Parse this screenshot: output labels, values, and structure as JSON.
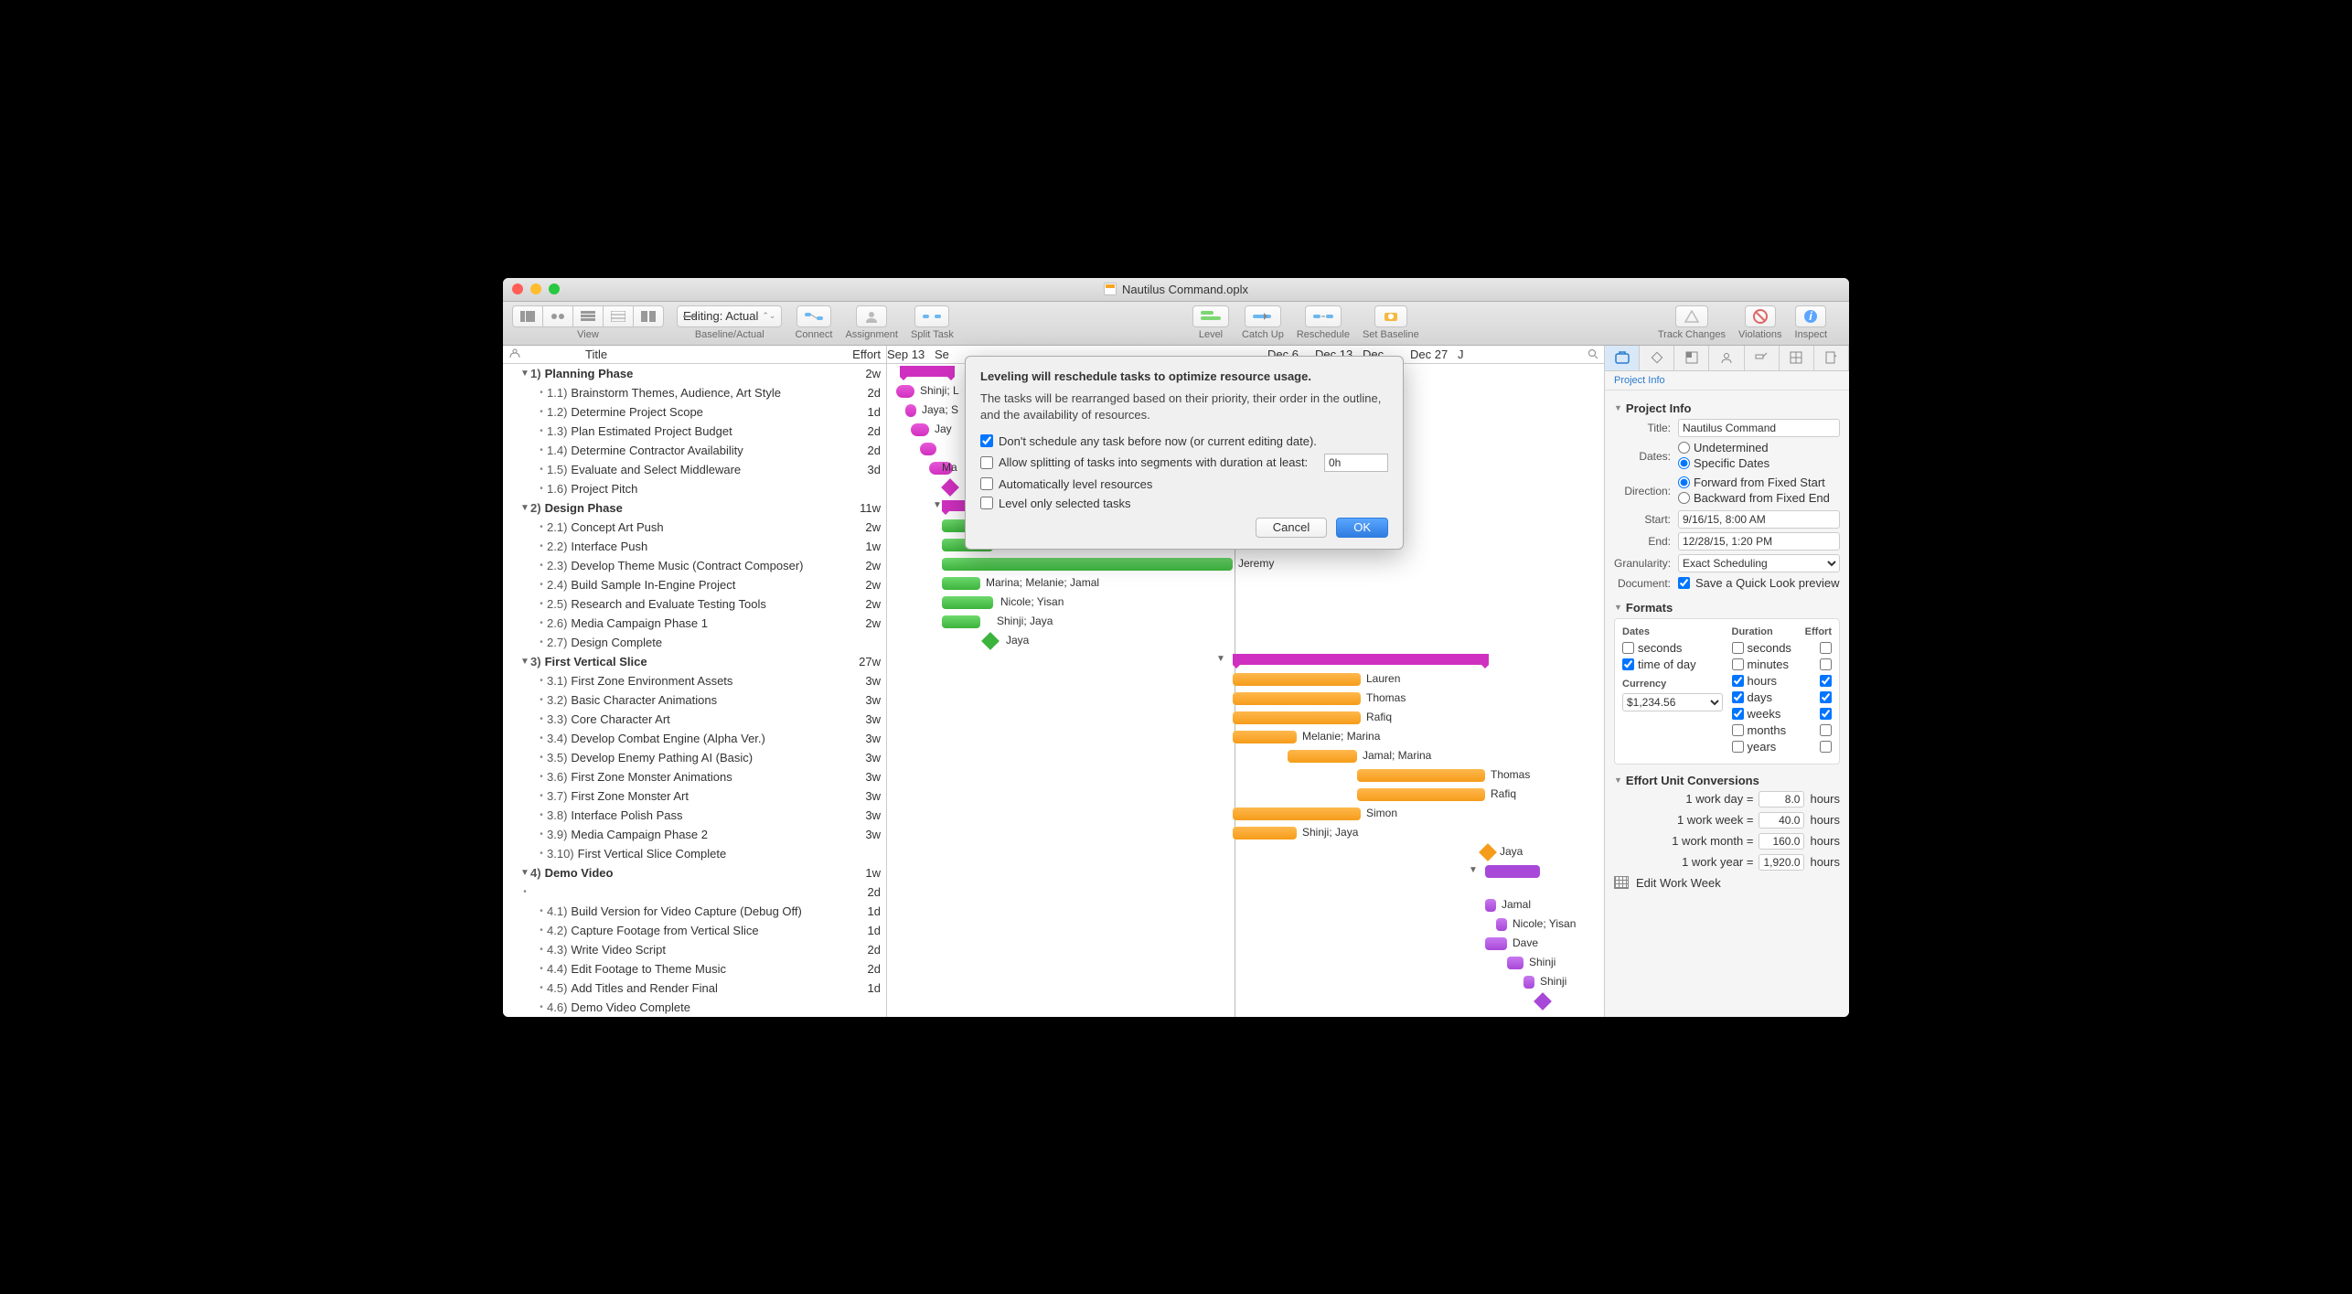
{
  "window_title": "Nautilus Command.oplx",
  "toolbar": {
    "view": "View",
    "baseline_actual": "Baseline/Actual",
    "editing_popup": "Editing: Actual",
    "connect": "Connect",
    "assignment": "Assignment",
    "split_task": "Split Task",
    "level": "Level",
    "catch_up": "Catch Up",
    "reschedule": "Reschedule",
    "set_baseline": "Set Baseline",
    "track_changes": "Track Changes",
    "violations": "Violations",
    "inspect": "Inspect"
  },
  "outline_header": {
    "title": "Title",
    "effort": "Effort"
  },
  "tasks": [
    {
      "lvl": 0,
      "grp": true,
      "num": "1)",
      "name": "Planning Phase",
      "effort": "2w"
    },
    {
      "lvl": 1,
      "num": "1.1)",
      "name": "Brainstorm Themes, Audience, Art Style",
      "effort": "2d"
    },
    {
      "lvl": 1,
      "num": "1.2)",
      "name": "Determine Project Scope",
      "effort": "1d"
    },
    {
      "lvl": 1,
      "num": "1.3)",
      "name": "Plan Estimated Project Budget",
      "effort": "2d"
    },
    {
      "lvl": 1,
      "num": "1.4)",
      "name": "Determine Contractor Availability",
      "effort": "2d"
    },
    {
      "lvl": 1,
      "num": "1.5)",
      "name": "Evaluate and Select Middleware",
      "effort": "3d"
    },
    {
      "lvl": 1,
      "num": "1.6)",
      "name": "Project Pitch",
      "effort": ""
    },
    {
      "lvl": 0,
      "grp": true,
      "num": "2)",
      "name": "Design Phase",
      "effort": "11w"
    },
    {
      "lvl": 1,
      "num": "2.1)",
      "name": "Concept Art Push",
      "effort": "2w"
    },
    {
      "lvl": 1,
      "num": "2.2)",
      "name": "Interface Push",
      "effort": "1w"
    },
    {
      "lvl": 1,
      "num": "2.3)",
      "name": "Develop Theme Music (Contract Composer)",
      "effort": "2w"
    },
    {
      "lvl": 1,
      "num": "2.4)",
      "name": "Build Sample In-Engine Project",
      "effort": "2w"
    },
    {
      "lvl": 1,
      "num": "2.5)",
      "name": "Research and Evaluate Testing Tools",
      "effort": "2w"
    },
    {
      "lvl": 1,
      "num": "2.6)",
      "name": "Media Campaign Phase 1",
      "effort": "2w"
    },
    {
      "lvl": 1,
      "num": "2.7)",
      "name": "Design Complete",
      "effort": ""
    },
    {
      "lvl": 0,
      "grp": true,
      "num": "3)",
      "name": "First Vertical Slice",
      "effort": "27w"
    },
    {
      "lvl": 1,
      "num": "3.1)",
      "name": "First Zone Environment Assets",
      "effort": "3w"
    },
    {
      "lvl": 1,
      "num": "3.2)",
      "name": "Basic Character Animations",
      "effort": "3w"
    },
    {
      "lvl": 1,
      "num": "3.3)",
      "name": "Core Character Art",
      "effort": "3w"
    },
    {
      "lvl": 1,
      "num": "3.4)",
      "name": "Develop Combat Engine (Alpha Ver.)",
      "effort": "3w"
    },
    {
      "lvl": 1,
      "num": "3.5)",
      "name": "Develop Enemy Pathing AI (Basic)",
      "effort": "3w"
    },
    {
      "lvl": 1,
      "num": "3.6)",
      "name": "First Zone Monster Animations",
      "effort": "3w"
    },
    {
      "lvl": 1,
      "num": "3.7)",
      "name": "First Zone Monster Art",
      "effort": "3w"
    },
    {
      "lvl": 1,
      "num": "3.8)",
      "name": "Interface Polish Pass",
      "effort": "3w"
    },
    {
      "lvl": 1,
      "num": "3.9)",
      "name": "Media Campaign Phase 2",
      "effort": "3w"
    },
    {
      "lvl": 1,
      "num": "3.10)",
      "name": "First Vertical Slice Complete",
      "effort": ""
    },
    {
      "lvl": 0,
      "grp": true,
      "num": "4)",
      "name": "Demo Video",
      "effort": "1w"
    },
    {
      "lvl": 0,
      "grp": false,
      "num": "",
      "name": "",
      "effort": "2d"
    },
    {
      "lvl": 1,
      "num": "4.1)",
      "name": "Build Version for Video Capture (Debug Off)",
      "effort": "1d"
    },
    {
      "lvl": 1,
      "num": "4.2)",
      "name": "Capture Footage from Vertical Slice",
      "effort": "1d"
    },
    {
      "lvl": 1,
      "num": "4.3)",
      "name": "Write Video Script",
      "effort": "2d"
    },
    {
      "lvl": 1,
      "num": "4.4)",
      "name": "Edit Footage to Theme Music",
      "effort": "2d"
    },
    {
      "lvl": 1,
      "num": "4.5)",
      "name": "Add Titles and Render Final",
      "effort": "1d"
    },
    {
      "lvl": 1,
      "num": "4.6)",
      "name": "Demo Video Complete",
      "effort": ""
    }
  ],
  "timeline_dates": [
    "Sep 13",
    "Se",
    "",
    "",
    "",
    "",
    "",
    "",
    "Dec 6",
    "Dec 13",
    "Dec",
    "Dec 27",
    "J"
  ],
  "gantt_labels": {
    "shinji_l": "Shinji; L",
    "jaya_s": "Jaya; S",
    "jay": "Jay",
    "ma": "Ma",
    "simon": "Simon",
    "jeremy": "Jeremy",
    "mmj": "Marina; Melanie; Jamal",
    "ny": "Nicole; Yisan",
    "sj": "Shinji; Jaya",
    "jaya": "Jaya",
    "lauren": "Lauren",
    "thomas": "Thomas",
    "rafiq": "Rafiq",
    "mm": "Melanie; Marina",
    "jm": "Jamal; Marina",
    "thomas2": "Thomas",
    "rafiq2": "Rafiq",
    "simon2": "Simon",
    "sj2": "Shinji; Jaya",
    "jaya2": "Jaya",
    "jamal": "Jamal",
    "nicole_y": "Nicole; Yisan",
    "dave": "Dave",
    "shinji": "Shinji",
    "shinji2": "Shinji"
  },
  "dialog": {
    "heading": "Leveling will reschedule tasks to optimize resource usage.",
    "body": "The tasks will be rearranged based on their priority, their order in the outline, and the availability of resources.",
    "chk_before": "Don't schedule any task before now (or current editing date).",
    "chk_split": "Allow splitting of tasks into segments with duration at least:",
    "split_val": "0h",
    "chk_auto": "Automatically level resources",
    "chk_sel": "Level only selected tasks",
    "cancel": "Cancel",
    "ok": "OK"
  },
  "inspector": {
    "tab_label": "Project Info",
    "sec_projinfo": "Project Info",
    "title_lbl": "Title:",
    "title_val": "Nautilus Command",
    "dates_lbl": "Dates:",
    "dates_undet": "Undetermined",
    "dates_spec": "Specific Dates",
    "dir_lbl": "Direction:",
    "dir_fwd": "Forward from Fixed Start",
    "dir_bwd": "Backward from Fixed End",
    "start_lbl": "Start:",
    "start_val": "9/16/15, 8:00 AM",
    "end_lbl": "End:",
    "end_val": "12/28/15, 1:20 PM",
    "gran_lbl": "Granularity:",
    "gran_val": "Exact Scheduling",
    "doc_lbl": "Document:",
    "doc_ql": "Save a Quick Look preview",
    "sec_formats": "Formats",
    "fmt_dates": "Dates",
    "fmt_seconds": "seconds",
    "fmt_tod": "time of day",
    "fmt_currency": "Currency",
    "fmt_cur_val": "$1,234.56",
    "fmt_duration": "Duration",
    "fmt_effort": "Effort",
    "fmt_min": "minutes",
    "fmt_hours": "hours",
    "fmt_days": "days",
    "fmt_weeks": "weeks",
    "fmt_months": "months",
    "fmt_years": "years",
    "sec_conv": "Effort Unit Conversions",
    "conv_day": "1 work day =",
    "conv_day_v": "8.0",
    "conv_day_u": "hours",
    "conv_week": "1 work week =",
    "conv_week_v": "40.0",
    "conv_week_u": "hours",
    "conv_month": "1 work month =",
    "conv_month_v": "160.0",
    "conv_month_u": "hours",
    "conv_year": "1 work year =",
    "conv_year_v": "1,920.0",
    "conv_year_u": "hours",
    "edit_ww": "Edit Work Week"
  }
}
